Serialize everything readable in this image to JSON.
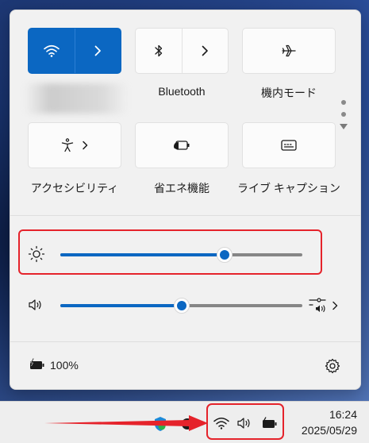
{
  "quick_settings": {
    "tiles": [
      {
        "id": "wifi",
        "label": "",
        "active": true,
        "has_chevron": true,
        "icon": "wifi-icon"
      },
      {
        "id": "bluetooth",
        "label": "Bluetooth",
        "active": false,
        "has_chevron": true,
        "icon": "bluetooth-icon"
      },
      {
        "id": "airplane",
        "label": "機内モード",
        "active": false,
        "has_chevron": false,
        "icon": "airplane-icon"
      },
      {
        "id": "accessibility",
        "label": "アクセシビリティ",
        "active": false,
        "has_chevron": true,
        "icon": "accessibility-icon"
      },
      {
        "id": "battery_saver",
        "label": "省エネ機能",
        "active": false,
        "has_chevron": false,
        "icon": "battery-saver-icon"
      },
      {
        "id": "live_captions",
        "label": "ライブ キャプション",
        "active": false,
        "has_chevron": false,
        "icon": "captions-icon"
      }
    ],
    "brightness": {
      "icon": "brightness-icon",
      "value_percent": 68
    },
    "volume": {
      "icon": "speaker-icon",
      "value_percent": 50,
      "output_icon": "sound-output-icon"
    },
    "battery": {
      "icon": "battery-charging-icon",
      "label": "100%"
    },
    "settings_icon": "gear-icon"
  },
  "taskbar": {
    "tray_icons": [
      "wifi-icon",
      "speaker-icon",
      "battery-charging-icon"
    ],
    "clock": {
      "time": "16:24",
      "date": "2025/05/29"
    }
  },
  "colors": {
    "accent": "#0b67c2",
    "highlight": "#e5232b"
  }
}
